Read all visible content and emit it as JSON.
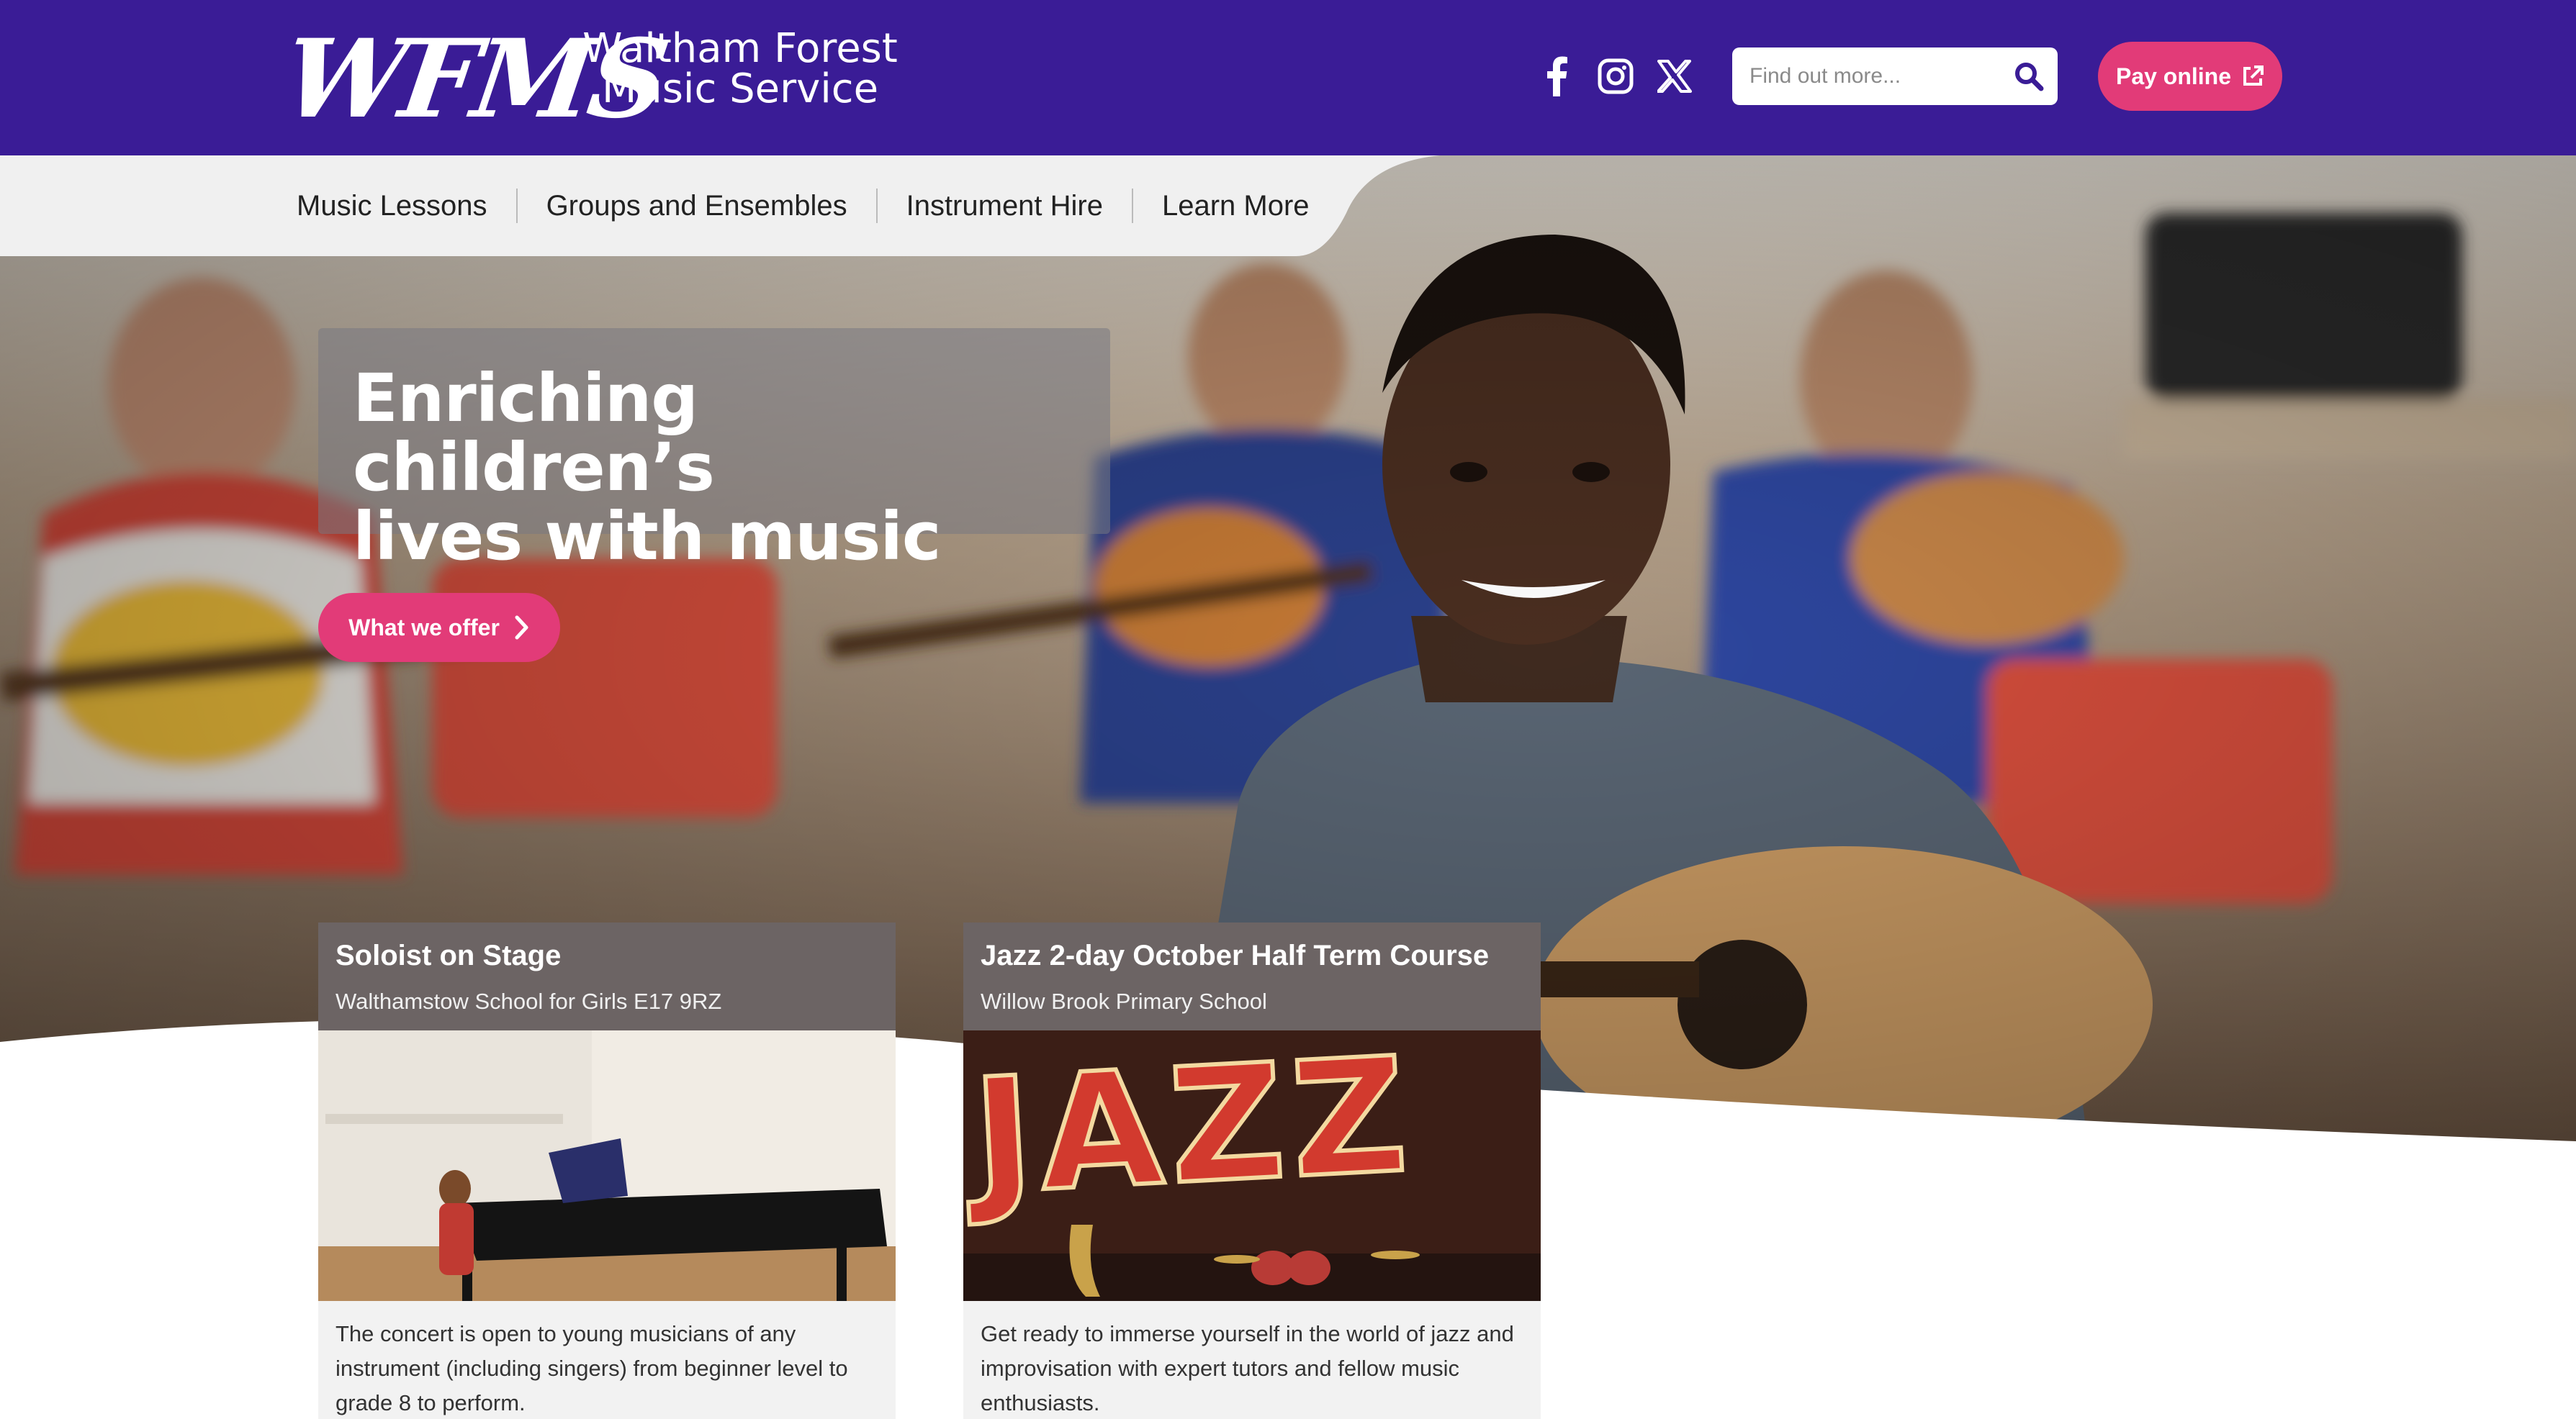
{
  "header": {
    "logo_text": "WFMS",
    "site_name_line1": "Waltham Forest",
    "site_name_line2": "Music Service",
    "social": [
      "facebook-icon",
      "instagram-icon",
      "x-icon"
    ],
    "search": {
      "placeholder": "Find out more..."
    },
    "pay_button": "Pay online"
  },
  "nav": {
    "items": [
      {
        "label": "Music Lessons"
      },
      {
        "label": "Groups and Ensembles"
      },
      {
        "label": "Instrument Hire"
      },
      {
        "label": "Learn More"
      }
    ]
  },
  "hero": {
    "headline_line1": "Enriching children’s",
    "headline_line2": "lives with music",
    "cta": "What we offer"
  },
  "events": [
    {
      "title": "Soloist on Stage",
      "location": "Walthamstow School for Girls E17 9RZ",
      "description": "The concert is open to young musicians of any instrument (including singers) from beginner level to grade 8 to perform."
    },
    {
      "title": "Jazz 2-day October Half Term Course",
      "location": "Willow Brook Primary School",
      "image_text": "JAZZ",
      "description": "Get ready to immerse yourself in the world of jazz and improvisation with expert tutors and fellow music enthusiasts."
    }
  ],
  "colors": {
    "header_bg": "#3a1c96",
    "accent_pink": "#e23b78",
    "nav_bg": "#f0f0f0"
  }
}
